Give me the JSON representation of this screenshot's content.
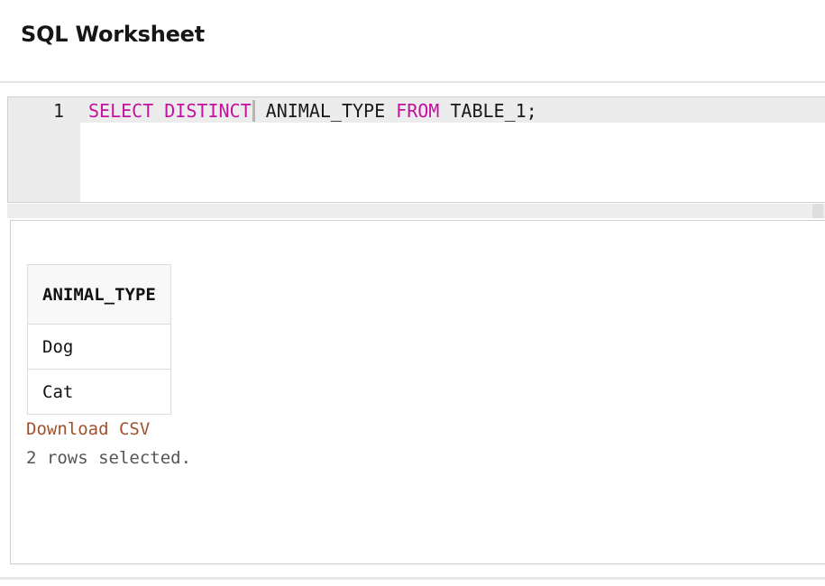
{
  "header": {
    "title": "SQL Worksheet"
  },
  "editor": {
    "line_number": "1",
    "tokens": [
      {
        "text": "SELECT DISTINCT",
        "kind": "keyword"
      },
      {
        "text": " ANIMAL_TYPE ",
        "kind": "identifier"
      },
      {
        "text": "FROM",
        "kind": "keyword"
      },
      {
        "text": " TABLE_1;",
        "kind": "identifier"
      }
    ],
    "keyword_color": "#c4119f"
  },
  "results": {
    "columns": [
      "ANIMAL_TYPE"
    ],
    "rows": [
      [
        "Dog"
      ],
      [
        "Cat"
      ]
    ],
    "download_label": "Download CSV",
    "link_color": "#a0522d",
    "status": "2 rows selected."
  }
}
